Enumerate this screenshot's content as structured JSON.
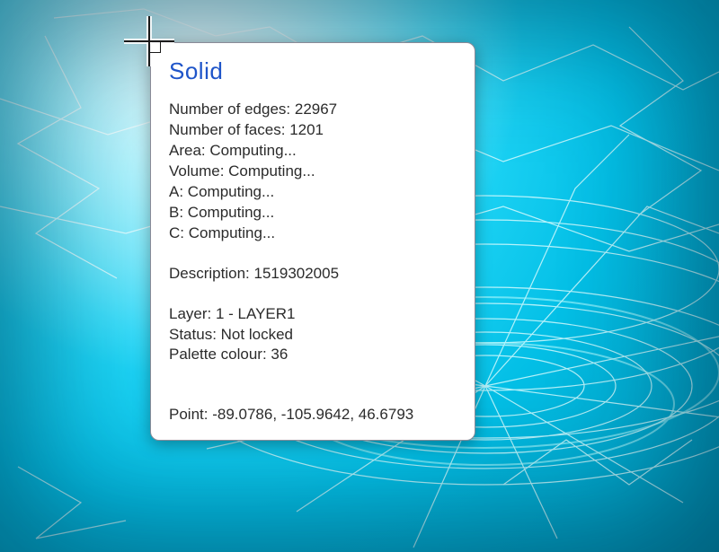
{
  "tooltip": {
    "title": "Solid",
    "rows": [
      {
        "label": "Number of edges",
        "value": "22967"
      },
      {
        "label": "Number of faces",
        "value": "1201"
      },
      {
        "label": "Area",
        "value": "Computing..."
      },
      {
        "label": "Volume",
        "value": "Computing..."
      },
      {
        "label": "A",
        "value": "Computing..."
      },
      {
        "label": "B",
        "value": "Computing..."
      },
      {
        "label": "C",
        "value": "Computing..."
      }
    ],
    "description": {
      "label": "Description",
      "value": "1519302005"
    },
    "meta": [
      {
        "label": "Layer",
        "value": "1 - LAYER1"
      },
      {
        "label": "Status",
        "value": "Not locked"
      },
      {
        "label": "Palette colour",
        "value": "36"
      }
    ],
    "point": {
      "label": "Point",
      "value": "-89.0786, -105.9642, 46.6793"
    }
  }
}
